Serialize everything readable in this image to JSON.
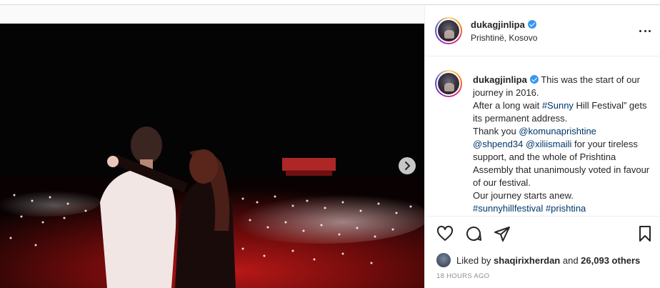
{
  "post": {
    "username": "dukagjinlipa",
    "location": "Prishtinë, Kosovo",
    "caption": {
      "username": "dukagjinlipa",
      "line1": " This was the start of our journey in 2016.",
      "line2_pre": "After a long wait ",
      "hashtag_festival": "#Sunny",
      "line2_post": " Hill Festival” gets its permanent address.",
      "line3_pre": "Thank you ",
      "mention1": "@komunaprishtine",
      "mention2": "@shpend34",
      "mention3": "@xiliismaili",
      "line3_post": " for your tireless support, and the whole of Prishtina Assembly that unanimously voted in favour of our festival.",
      "line4": "Our journey starts anew.",
      "hashtag1": "#sunnyhillfestival",
      "hashtag2": "#prishtina"
    },
    "likes": {
      "prefix": "Liked by ",
      "user": "shaqirixherdan",
      "middle": " and ",
      "count": "26,093 others"
    },
    "time": "18 HOURS AGO"
  },
  "icons": {
    "verified": "verified-badge-icon",
    "more": "more-options-icon",
    "like": "heart-icon",
    "comment": "comment-icon",
    "share": "paper-plane-icon",
    "save": "bookmark-icon",
    "next": "chevron-right-icon"
  },
  "colors": {
    "link": "#00376b",
    "verified": "#3897f0",
    "muted": "#8e8e8e"
  }
}
